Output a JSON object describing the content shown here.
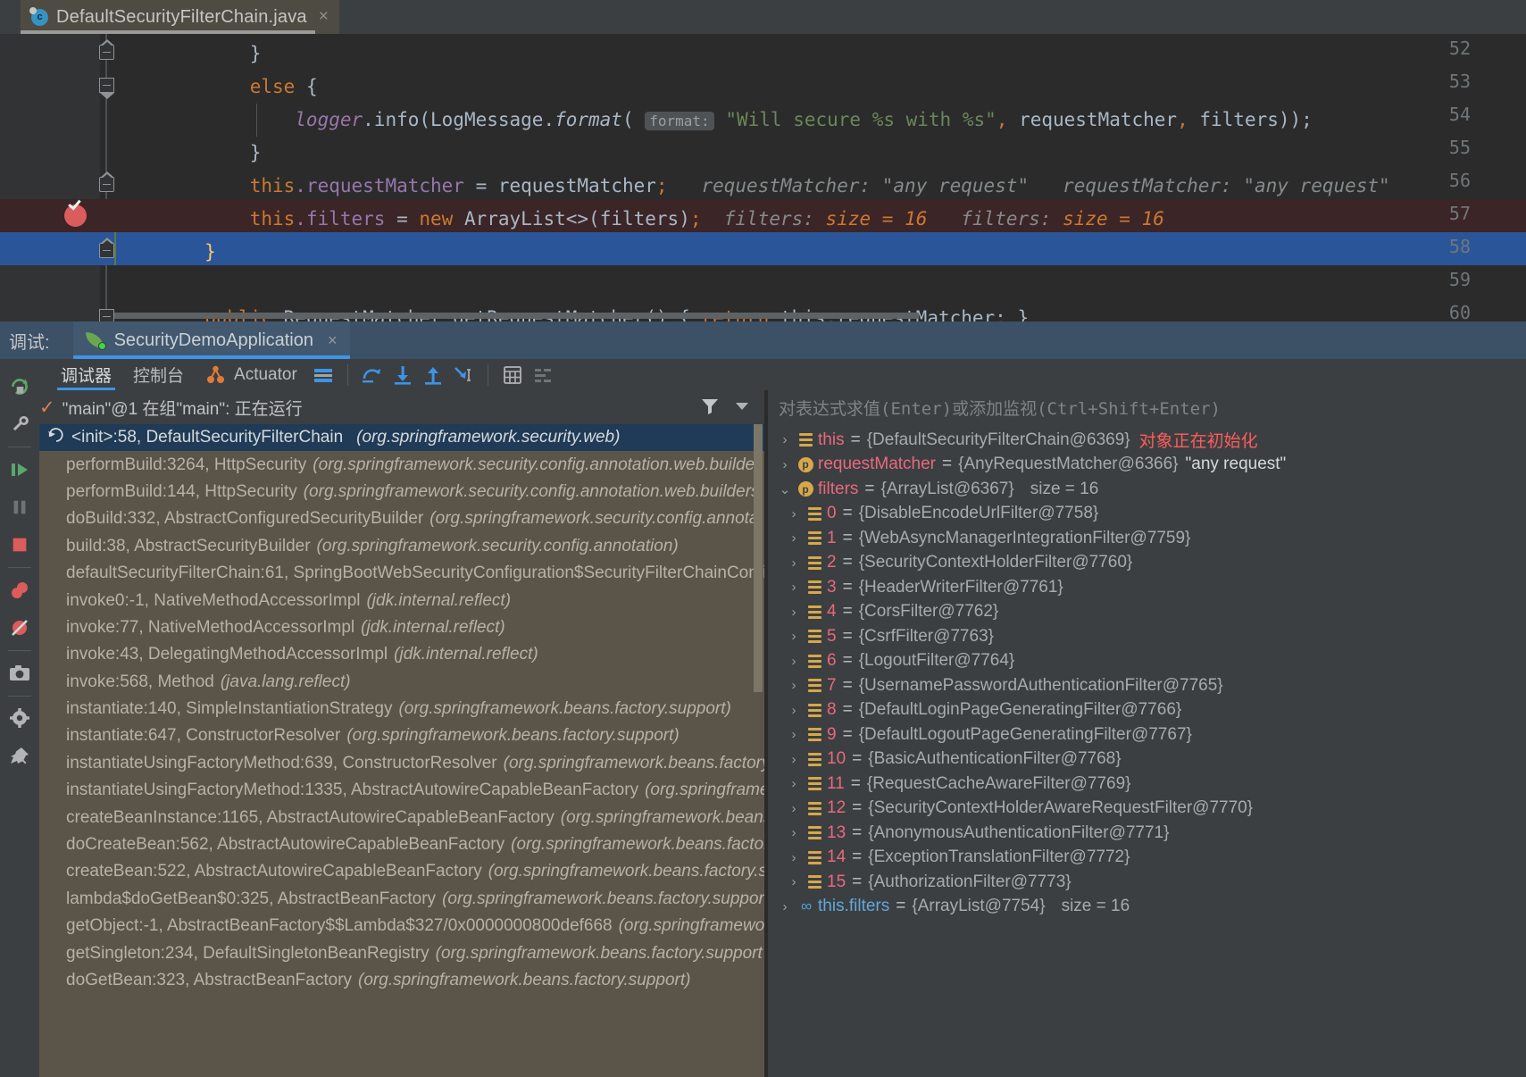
{
  "editor": {
    "tab": {
      "title": "DefaultSecurityFilterChain.java",
      "icon": "java-class-icon",
      "close": "×"
    },
    "lines": [
      {
        "num": "52",
        "text": "            }"
      },
      {
        "num": "53",
        "text": "            else {"
      },
      {
        "num": "54",
        "text": "                logger.info(LogMessage.format("
      },
      {
        "num": "55",
        "text": "            }"
      },
      {
        "num": "56",
        "text": "            this.requestMatcher = requestMatcher;"
      },
      {
        "num": "57",
        "text": "            this.filters = new ArrayList<>(filters);"
      },
      {
        "num": "58",
        "text": "        }"
      },
      {
        "num": "59",
        "text": ""
      },
      {
        "num": "60",
        "text": "        public RequestMatcher getRequestMatcher() { return this.requestMatcher; }"
      }
    ],
    "line54": {
      "indent": "                ",
      "logger": "logger",
      "dot_info": ".info(LogMessage.",
      "format": "format",
      "open": "(",
      "param_hint": "format:",
      "string": "\"Will secure %s with %s\"",
      "comma1": ",",
      "arg1": " requestMatcher",
      "comma2": ",",
      "arg2": " filters));"
    },
    "line56": {
      "this": "this",
      "field": ".requestMatcher",
      "assign": " = requestMatcher;",
      "hint1_name": "requestMatcher:",
      "hint1_val": "\"any request\"",
      "hint2_name": "requestMatcher:",
      "hint2_val": "\"any request\""
    },
    "line57": {
      "this": "this",
      "field": ".filters",
      "eq": " = ",
      "new": "new",
      "rest": " ArrayList<>(filters);",
      "hint1_name": "filters:",
      "hint1_val": "size = 16",
      "hint2_name": "filters:",
      "hint2_val": "size = 16"
    },
    "line60": {
      "kw1": "public",
      "rest1": " RequestMatcher getRequestMatcher() { ",
      "kw2": "return",
      "rest2": " this.requestMatcher; }"
    },
    "breakpoint_line": "57",
    "execution_line": "58"
  },
  "debug_panel": {
    "label": "调试:",
    "session_tab": "SecurityDemoApplication",
    "session_close": "×",
    "tabs": [
      {
        "label": "调试器",
        "active": true
      },
      {
        "label": "控制台",
        "active": false
      },
      {
        "label": "Actuator",
        "active": false,
        "icon": "actuator-icon"
      }
    ],
    "toolbar_icons": [
      "layout-settings-icon",
      "step-over-icon",
      "step-into-icon",
      "step-out-icon",
      "run-to-cursor-icon",
      "evaluate-expression-icon",
      "settings-list-icon"
    ],
    "left_toolbar_icons": [
      "rerun-icon",
      "wrench-icon",
      "resume-icon",
      "pause-icon",
      "stop-icon",
      "view-breakpoints-icon",
      "mute-breakpoints-icon",
      "camera-icon",
      "gear-icon"
    ]
  },
  "frames": {
    "thread_status": "\"main\"@1 在组\"main\": 正在运行",
    "filter_icon": "filter-icon",
    "dropdown_icon": "chevron-down-icon",
    "selected_index": 0,
    "items": [
      {
        "method": "<init>:58, DefaultSecurityFilterChain",
        "pkg": "(org.springframework.security.web)",
        "selected": true
      },
      {
        "method": "performBuild:3264, HttpSecurity",
        "pkg": "(org.springframework.security.config.annotation.web.builde"
      },
      {
        "method": "performBuild:144, HttpSecurity",
        "pkg": "(org.springframework.security.config.annotation.web.builders"
      },
      {
        "method": "doBuild:332, AbstractConfiguredSecurityBuilder",
        "pkg": "(org.springframework.security.config.annota"
      },
      {
        "method": "build:38, AbstractSecurityBuilder",
        "pkg": "(org.springframework.security.config.annotation)"
      },
      {
        "method": "defaultSecurityFilterChain:61, SpringBootWebSecurityConfiguration$SecurityFilterChainConfi",
        "pkg": ""
      },
      {
        "method": "invoke0:-1, NativeMethodAccessorImpl",
        "pkg": "(jdk.internal.reflect)"
      },
      {
        "method": "invoke:77, NativeMethodAccessorImpl",
        "pkg": "(jdk.internal.reflect)"
      },
      {
        "method": "invoke:43, DelegatingMethodAccessorImpl",
        "pkg": "(jdk.internal.reflect)"
      },
      {
        "method": "invoke:568, Method",
        "pkg": "(java.lang.reflect)"
      },
      {
        "method": "instantiate:140, SimpleInstantiationStrategy",
        "pkg": "(org.springframework.beans.factory.support)"
      },
      {
        "method": "instantiate:647, ConstructorResolver",
        "pkg": "(org.springframework.beans.factory.support)"
      },
      {
        "method": "instantiateUsingFactoryMethod:639, ConstructorResolver",
        "pkg": "(org.springframework.beans.factory"
      },
      {
        "method": "instantiateUsingFactoryMethod:1335, AbstractAutowireCapableBeanFactory",
        "pkg": "(org.springframe"
      },
      {
        "method": "createBeanInstance:1165, AbstractAutowireCapableBeanFactory",
        "pkg": "(org.springframework.beans"
      },
      {
        "method": "doCreateBean:562, AbstractAutowireCapableBeanFactory",
        "pkg": "(org.springframework.beans.factor"
      },
      {
        "method": "createBean:522, AbstractAutowireCapableBeanFactory",
        "pkg": "(org.springframework.beans.factory.s"
      },
      {
        "method": "lambda$doGetBean$0:325, AbstractBeanFactory",
        "pkg": "(org.springframework.beans.factory.support"
      },
      {
        "method": "getObject:-1, AbstractBeanFactory$$Lambda$327/0x0000000800def668",
        "pkg": "(org.springframewor"
      },
      {
        "method": "getSingleton:234, DefaultSingletonBeanRegistry",
        "pkg": "(org.springframework.beans.factory.support"
      },
      {
        "method": "doGetBean:323, AbstractBeanFactory",
        "pkg": "(org.springframework.beans.factory.support)"
      }
    ]
  },
  "variables": {
    "eval_placeholder": "对表达式求值(Enter)或添加监视(Ctrl+Shift+Enter)",
    "rows": [
      {
        "indent": 0,
        "arrow": "›",
        "icon": "list-icon",
        "name": "this",
        "value": "{DefaultSecurityFilterChain@6369}",
        "note": "对象正在初始化"
      },
      {
        "indent": 0,
        "arrow": "›",
        "icon": "param-icon",
        "name": "requestMatcher",
        "value": "{AnyRequestMatcher@6366}",
        "str": "\"any request\""
      },
      {
        "indent": 0,
        "arrow": "⌄",
        "icon": "param-icon",
        "name": "filters",
        "value": "{ArrayList@6367}",
        "size": "size = 16"
      },
      {
        "indent": 1,
        "arrow": "›",
        "icon": "list-icon",
        "name": "0",
        "value": "{DisableEncodeUrlFilter@7758}"
      },
      {
        "indent": 1,
        "arrow": "›",
        "icon": "list-icon",
        "name": "1",
        "value": "{WebAsyncManagerIntegrationFilter@7759}"
      },
      {
        "indent": 1,
        "arrow": "›",
        "icon": "list-icon",
        "name": "2",
        "value": "{SecurityContextHolderFilter@7760}"
      },
      {
        "indent": 1,
        "arrow": "›",
        "icon": "list-icon",
        "name": "3",
        "value": "{HeaderWriterFilter@7761}"
      },
      {
        "indent": 1,
        "arrow": "›",
        "icon": "list-icon",
        "name": "4",
        "value": "{CorsFilter@7762}"
      },
      {
        "indent": 1,
        "arrow": "›",
        "icon": "list-icon",
        "name": "5",
        "value": "{CsrfFilter@7763}"
      },
      {
        "indent": 1,
        "arrow": "›",
        "icon": "list-icon",
        "name": "6",
        "value": "{LogoutFilter@7764}"
      },
      {
        "indent": 1,
        "arrow": "›",
        "icon": "list-icon",
        "name": "7",
        "value": "{UsernamePasswordAuthenticationFilter@7765}"
      },
      {
        "indent": 1,
        "arrow": "›",
        "icon": "list-icon",
        "name": "8",
        "value": "{DefaultLoginPageGeneratingFilter@7766}"
      },
      {
        "indent": 1,
        "arrow": "›",
        "icon": "list-icon",
        "name": "9",
        "value": "{DefaultLogoutPageGeneratingFilter@7767}"
      },
      {
        "indent": 1,
        "arrow": "›",
        "icon": "list-icon",
        "name": "10",
        "value": "{BasicAuthenticationFilter@7768}"
      },
      {
        "indent": 1,
        "arrow": "›",
        "icon": "list-icon",
        "name": "11",
        "value": "{RequestCacheAwareFilter@7769}"
      },
      {
        "indent": 1,
        "arrow": "›",
        "icon": "list-icon",
        "name": "12",
        "value": "{SecurityContextHolderAwareRequestFilter@7770}"
      },
      {
        "indent": 1,
        "arrow": "›",
        "icon": "list-icon",
        "name": "13",
        "value": "{AnonymousAuthenticationFilter@7771}"
      },
      {
        "indent": 1,
        "arrow": "›",
        "icon": "list-icon",
        "name": "14",
        "value": "{ExceptionTranslationFilter@7772}"
      },
      {
        "indent": 1,
        "arrow": "›",
        "icon": "list-icon",
        "name": "15",
        "value": "{AuthorizationFilter@7773}"
      },
      {
        "indent": 0,
        "arrow": "›",
        "icon": "watch-icon",
        "name": "this.filters",
        "nameStyle": "blue",
        "value": "{ArrayList@7754}",
        "size": "size = 16"
      }
    ]
  },
  "colors": {
    "accent_blue": "#3d94e8",
    "exec_line": "#2a5699",
    "breakpoint_red": "#db5c5c",
    "frames_bg": "#5b5549",
    "editor_bg": "#2b2b2b"
  }
}
